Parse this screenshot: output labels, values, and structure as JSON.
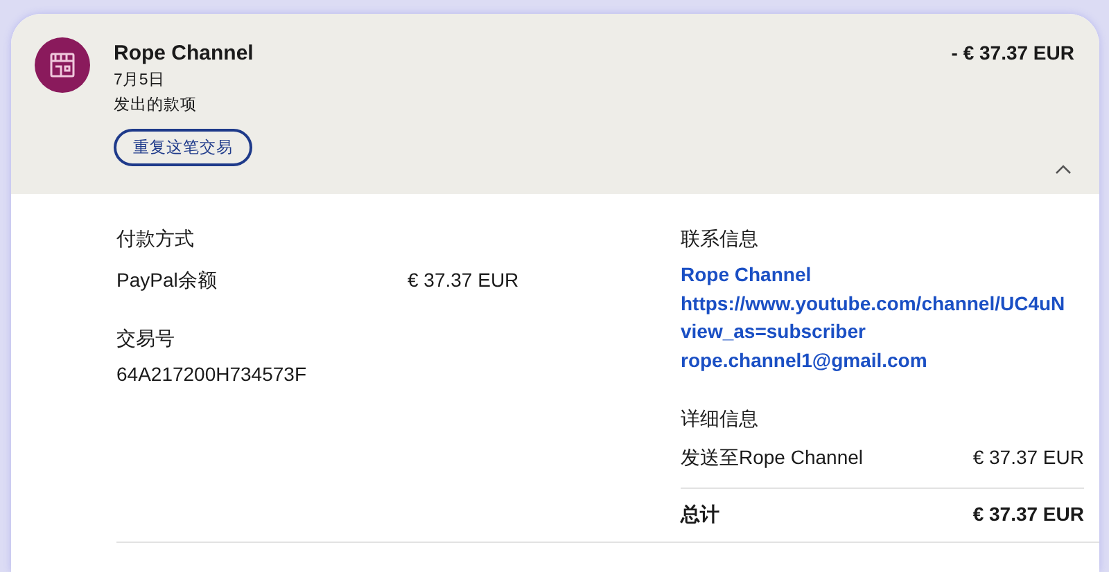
{
  "transaction": {
    "merchant": "Rope Channel",
    "date": "7月5日",
    "type": "发出的款项",
    "repeat_button": "重复这笔交易",
    "amount": "- € 37.37 EUR",
    "expanded": true
  },
  "payment": {
    "label": "付款方式",
    "method": "PayPal余额",
    "amount": "€ 37.37 EUR"
  },
  "transaction_id": {
    "label": "交易号",
    "value": "64A217200H734573F"
  },
  "contact": {
    "label": "联系信息",
    "lines": [
      "Rope Channel",
      "https://www.youtube.com/channel/UC4uN",
      "view_as=subscriber",
      "rope.channel1@gmail.com"
    ]
  },
  "details": {
    "label": "详细信息",
    "rows": [
      {
        "label": "发送至Rope Channel",
        "amount": "€ 37.37 EUR",
        "kind": "item"
      },
      {
        "label": "总计",
        "amount": "€ 37.37 EUR",
        "kind": "total"
      }
    ]
  }
}
